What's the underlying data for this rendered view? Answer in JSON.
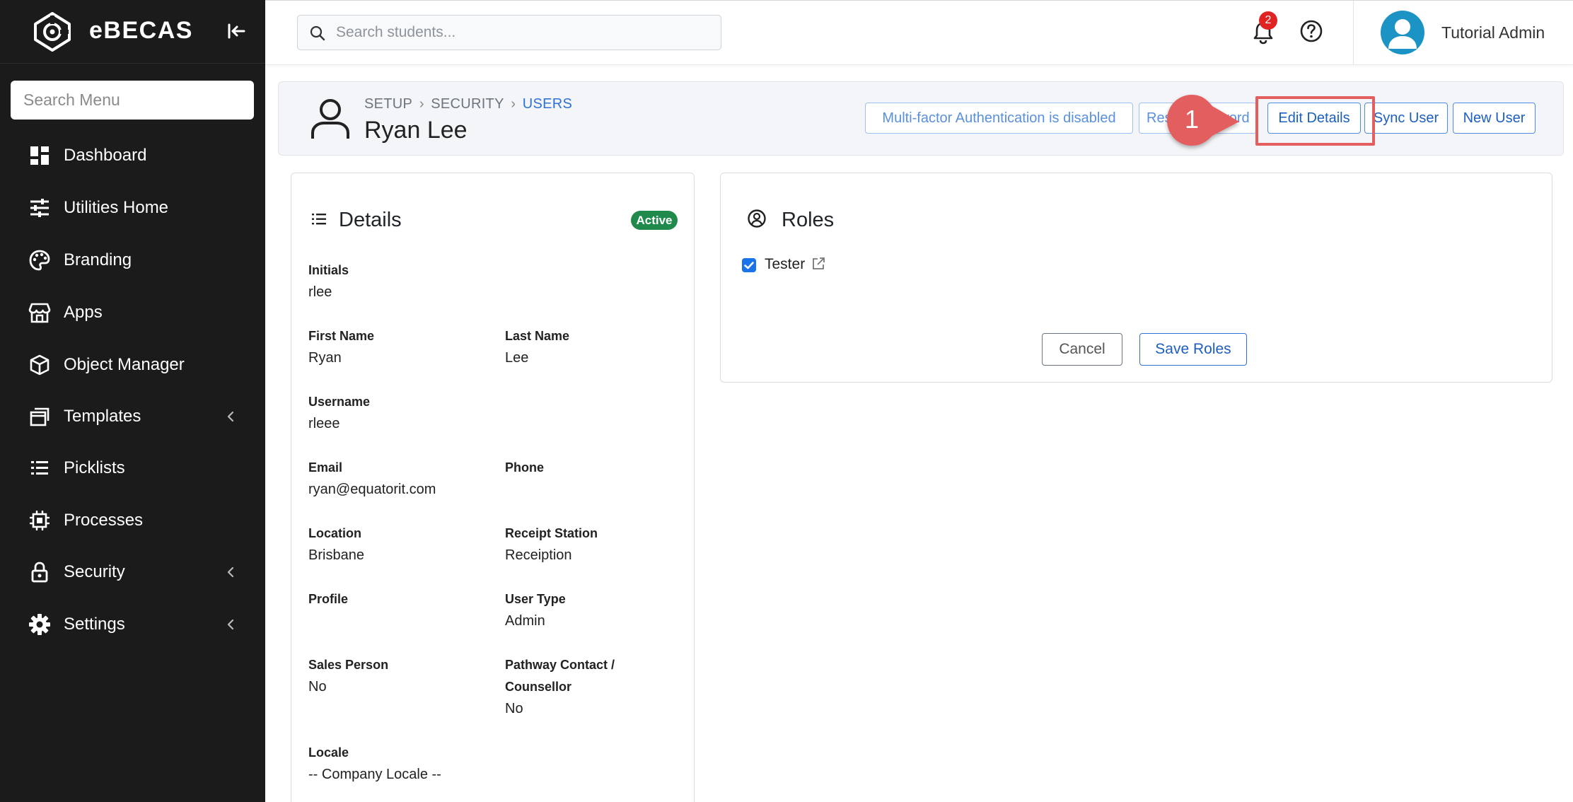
{
  "brand": {
    "name": "eBECAS"
  },
  "sidebar": {
    "search_placeholder": "Search Menu",
    "items": [
      {
        "label": "Dashboard",
        "icon": "dashboard-icon"
      },
      {
        "label": "Utilities Home",
        "icon": "sliders-icon"
      },
      {
        "label": "Branding",
        "icon": "palette-icon"
      },
      {
        "label": "Apps",
        "icon": "store-icon"
      },
      {
        "label": "Object Manager",
        "icon": "cube-icon"
      },
      {
        "label": "Templates",
        "icon": "window-stack-icon",
        "has_children": true
      },
      {
        "label": "Picklists",
        "icon": "list-icon"
      },
      {
        "label": "Processes",
        "icon": "chip-icon"
      },
      {
        "label": "Security",
        "icon": "lock-icon",
        "has_children": true
      },
      {
        "label": "Settings",
        "icon": "gear-icon",
        "has_children": true
      }
    ]
  },
  "topbar": {
    "search_placeholder": "Search students...",
    "notification_count": "2",
    "user_name": "Tutorial Admin"
  },
  "header": {
    "breadcrumb": [
      "SETUP",
      "SECURITY",
      "USERS"
    ],
    "title": "Ryan Lee",
    "buttons": {
      "mfa": "Multi-factor Authentication is disabled",
      "reset_password": "Reset Password",
      "edit_details": "Edit Details",
      "sync_user": "Sync User",
      "new_user": "New User"
    }
  },
  "annotation": {
    "step": "1",
    "color": "#e35e5e"
  },
  "details": {
    "title": "Details",
    "status": "Active",
    "fields": {
      "initials": {
        "label": "Initials",
        "value": "rlee"
      },
      "first_name": {
        "label": "First Name",
        "value": "Ryan"
      },
      "last_name": {
        "label": "Last Name",
        "value": "Lee"
      },
      "username": {
        "label": "Username",
        "value": "rleee"
      },
      "email": {
        "label": "Email",
        "value": "ryan@equatorit.com"
      },
      "phone": {
        "label": "Phone",
        "value": ""
      },
      "location": {
        "label": "Location",
        "value": "Brisbane"
      },
      "receipt_station": {
        "label": "Receipt Station",
        "value": "Receiption"
      },
      "profile": {
        "label": "Profile",
        "value": ""
      },
      "user_type": {
        "label": "User Type",
        "value": "Admin"
      },
      "sales_person": {
        "label": "Sales Person",
        "value": "No"
      },
      "pathway_contact": {
        "label_line1": "Pathway Contact /",
        "label_line2": "Counsellor",
        "value": "No"
      },
      "locale": {
        "label": "Locale",
        "value": "-- Company Locale --"
      }
    }
  },
  "roles": {
    "title": "Roles",
    "items": [
      {
        "label": "Tester",
        "checked": true
      }
    ],
    "cancel_label": "Cancel",
    "save_label": "Save Roles"
  },
  "colors": {
    "sidebar_bg": "#1b1b1b",
    "accent_blue": "#2f72d6",
    "active_green": "#1f8a4c",
    "badge_red": "#e02424",
    "avatar_blue": "#1b93c4"
  }
}
